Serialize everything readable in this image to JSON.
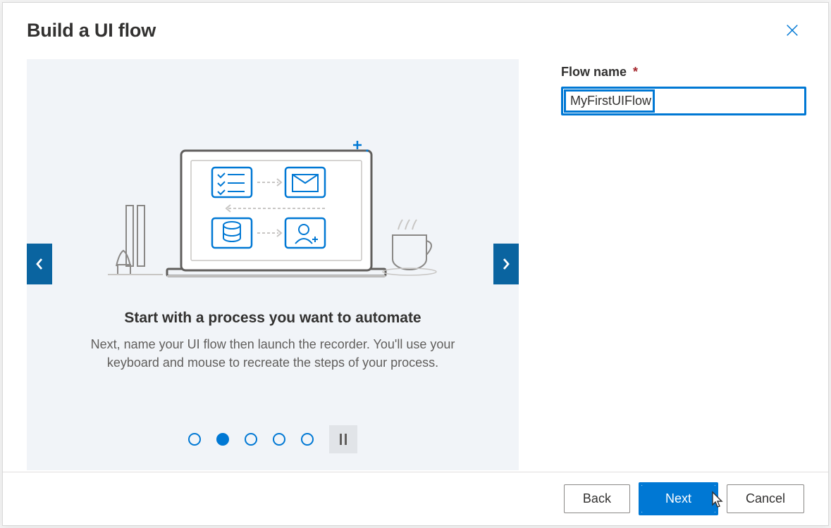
{
  "dialog": {
    "title": "Build a UI flow"
  },
  "carousel": {
    "slide_title": "Start with a process you want to automate",
    "slide_text": "Next, name your UI flow then launch the recorder. You'll use your keyboard and mouse to recreate the steps of your process.",
    "active_index": 1,
    "total_slides": 5
  },
  "form": {
    "flow_name_label": "Flow name",
    "required_marker": "*",
    "flow_name_value": "MyFirstUIFlow"
  },
  "footer": {
    "back_label": "Back",
    "next_label": "Next",
    "cancel_label": "Cancel"
  },
  "colors": {
    "accent": "#0078d4",
    "gray_bg": "#f1f4f8"
  }
}
